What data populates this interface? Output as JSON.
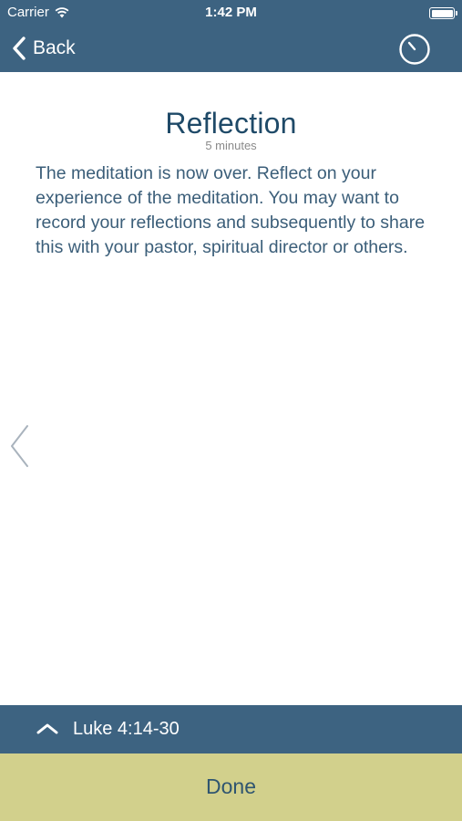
{
  "status_bar": {
    "carrier": "Carrier",
    "time": "1:42 PM",
    "wifi_icon": "wifi-icon",
    "battery_icon": "battery-icon"
  },
  "navbar": {
    "back_label": "Back",
    "back_icon": "chevron-left-icon",
    "timer_icon": "timer-icon",
    "background_color": "#3d6381"
  },
  "content": {
    "title": "Reflection",
    "duration": "5 minutes",
    "body": "The meditation is now over. Reflect on your experience of the meditation. You may want to record your reflections and subsequently to share this with your pastor, spiritual director or others.",
    "prev_icon": "chevron-left-icon"
  },
  "passage_bar": {
    "reference": "Luke 4:14-30",
    "icon": "chevron-up-icon"
  },
  "done_bar": {
    "label": "Done",
    "background_color": "#d2d08c"
  }
}
